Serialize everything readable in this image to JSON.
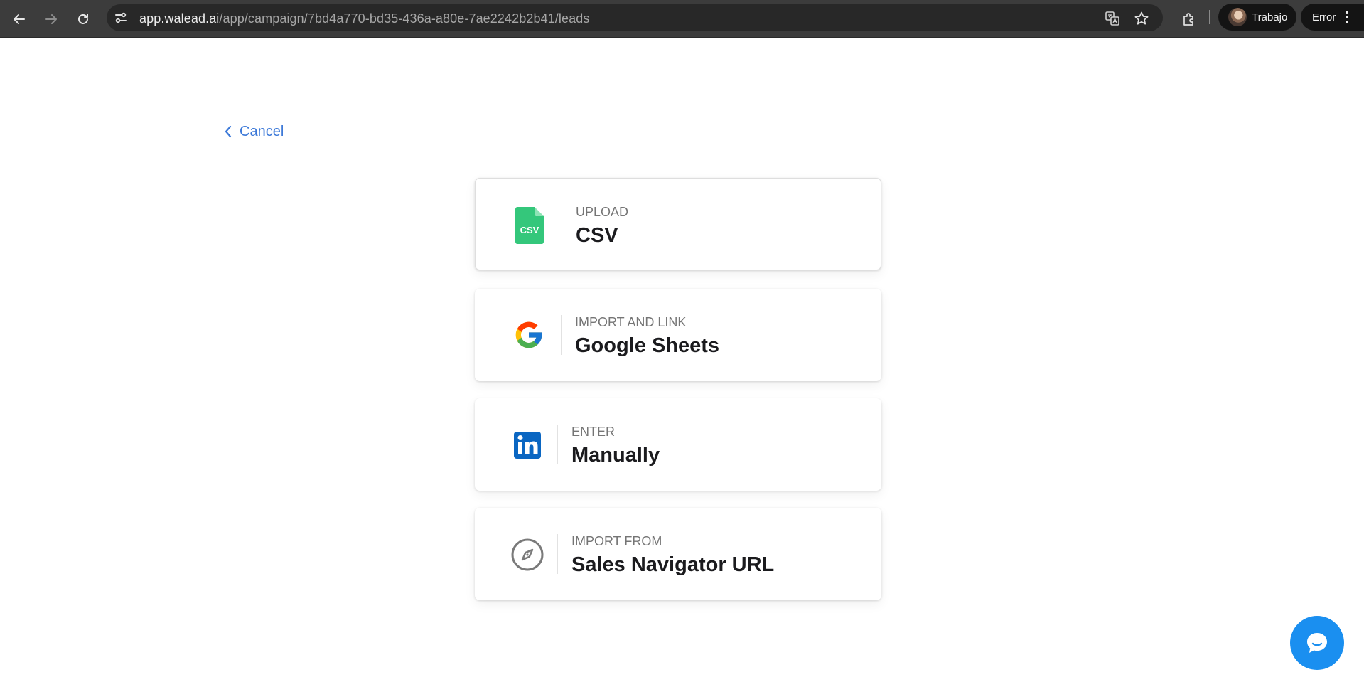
{
  "browser": {
    "url_host": "app.walead.ai",
    "url_path": "/app/campaign/7bd4a770-bd35-436a-a80e-7ae2242b2b41/leads",
    "profile_name": "Trabajo",
    "error_label": "Error"
  },
  "page": {
    "cancel_label": "Cancel",
    "options": [
      {
        "subtitle": "UPLOAD",
        "title": "CSV",
        "icon": "csv-file-icon",
        "icon_text": "CSV"
      },
      {
        "subtitle": "IMPORT AND LINK",
        "title": "Google Sheets",
        "icon": "google-icon"
      },
      {
        "subtitle": "ENTER",
        "title": "Manually",
        "icon": "linkedin-icon"
      },
      {
        "subtitle": "IMPORT FROM",
        "title": "Sales Navigator URL",
        "icon": "compass-icon"
      }
    ]
  },
  "colors": {
    "accent": "#3b78d8",
    "csv_green": "#34c77b",
    "linkedin_blue": "#0a66c2",
    "chat_blue": "#1a8ff0"
  }
}
